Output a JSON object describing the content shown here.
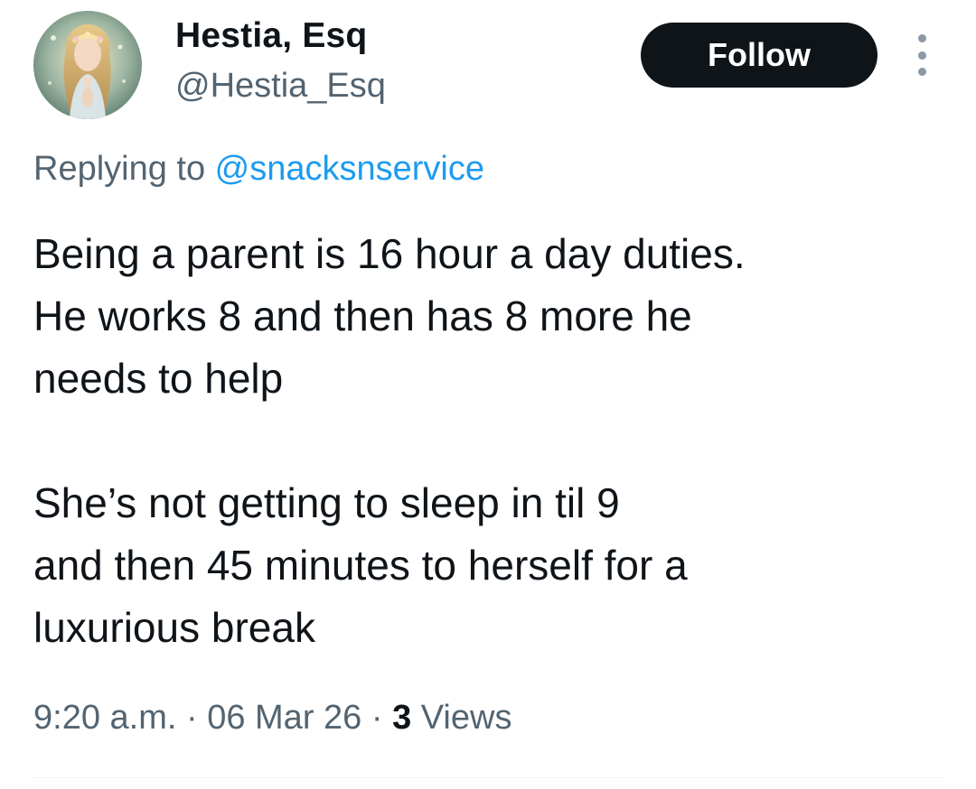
{
  "author": {
    "display_name": "Hestia, Esq",
    "handle": "@Hestia_Esq",
    "avatar_icon": "fairy-portrait-avatar"
  },
  "actions": {
    "follow_label": "Follow",
    "more_icon": "more-vertical-icon"
  },
  "reply": {
    "prefix": "Replying to ",
    "target": "@snacksnservice"
  },
  "tweet": {
    "paragraphs": [
      "Being a parent is 16 hour a day duties.\nHe works 8 and then has 8 more he\nneeds to help",
      "She’s not getting to sleep in til 9\nand then 45 minutes to herself for a\nluxurious break"
    ]
  },
  "meta": {
    "time": "9:20 a.m.",
    "separator": " · ",
    "date": "06 Mar 26",
    "views_count": "3",
    "views_label": " Views"
  },
  "colors": {
    "text_primary": "#0f1419",
    "text_secondary": "#536471",
    "link": "#1d9bf0",
    "follow_bg": "#0f1419",
    "divider": "#eff3f4"
  }
}
